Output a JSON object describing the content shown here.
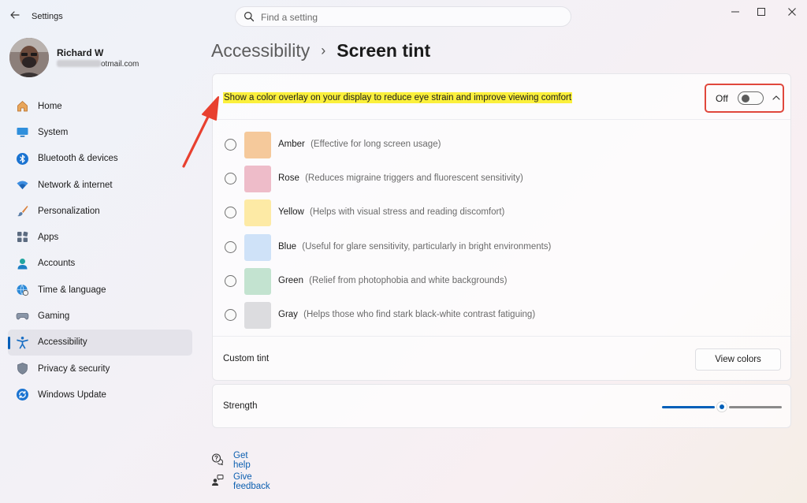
{
  "window": {
    "app_title": "Settings",
    "back_icon": "arrow-left-icon",
    "controls": [
      "minimize-icon",
      "maximize-icon",
      "close-icon"
    ]
  },
  "search": {
    "placeholder": "Find a setting"
  },
  "profile": {
    "name": "Richard W",
    "email_suffix": "otmail.com"
  },
  "sidebar": {
    "active": "Accessibility",
    "items": [
      {
        "id": "home",
        "label": "Home",
        "icon": "home-icon"
      },
      {
        "id": "system",
        "label": "System",
        "icon": "monitor-icon"
      },
      {
        "id": "bluetooth",
        "label": "Bluetooth & devices",
        "icon": "bluetooth-icon"
      },
      {
        "id": "network",
        "label": "Network & internet",
        "icon": "wifi-icon"
      },
      {
        "id": "personalization",
        "label": "Personalization",
        "icon": "paintbrush-icon"
      },
      {
        "id": "apps",
        "label": "Apps",
        "icon": "apps-icon"
      },
      {
        "id": "accounts",
        "label": "Accounts",
        "icon": "person-icon"
      },
      {
        "id": "time",
        "label": "Time & language",
        "icon": "globe-clock-icon"
      },
      {
        "id": "gaming",
        "label": "Gaming",
        "icon": "gamepad-icon"
      },
      {
        "id": "accessibility",
        "label": "Accessibility",
        "icon": "accessibility-icon"
      },
      {
        "id": "privacy",
        "label": "Privacy & security",
        "icon": "shield-icon"
      },
      {
        "id": "update",
        "label": "Windows Update",
        "icon": "sync-icon"
      }
    ]
  },
  "header": {
    "parent": "Accessibility",
    "separator": "›",
    "current": "Screen tint"
  },
  "screen_tint": {
    "overlay_label": "Show a color overlay on your display to reduce eye strain and improve viewing comfort",
    "toggle_state": "Off",
    "tints": [
      {
        "name": "Amber",
        "desc": "(Effective for long screen usage)",
        "color": "#f5c99b"
      },
      {
        "name": "Rose",
        "desc": "(Reduces migraine triggers and fluorescent sensitivity)",
        "color": "#eebcc9"
      },
      {
        "name": "Yellow",
        "desc": "(Helps with visual stress and reading discomfort)",
        "color": "#fdeaa5"
      },
      {
        "name": "Blue",
        "desc": "(Useful for glare sensitivity, particularly in bright environments)",
        "color": "#cfe2f8"
      },
      {
        "name": "Green",
        "desc": "(Relief from photophobia and white backgrounds)",
        "color": "#c3e3d0"
      },
      {
        "name": "Gray",
        "desc": "(Helps those who find stark black-white contrast fatiguing)",
        "color": "#dcdcdf"
      }
    ],
    "custom_tint_label": "Custom tint",
    "view_colors_label": "View colors",
    "strength_label": "Strength",
    "strength_value": 0.5
  },
  "help": {
    "get_help": "Get help",
    "give_feedback": "Give feedback"
  },
  "colors": {
    "accent": "#005fb8",
    "highlight": "#fbf03c",
    "annotation": "#e0473c"
  }
}
